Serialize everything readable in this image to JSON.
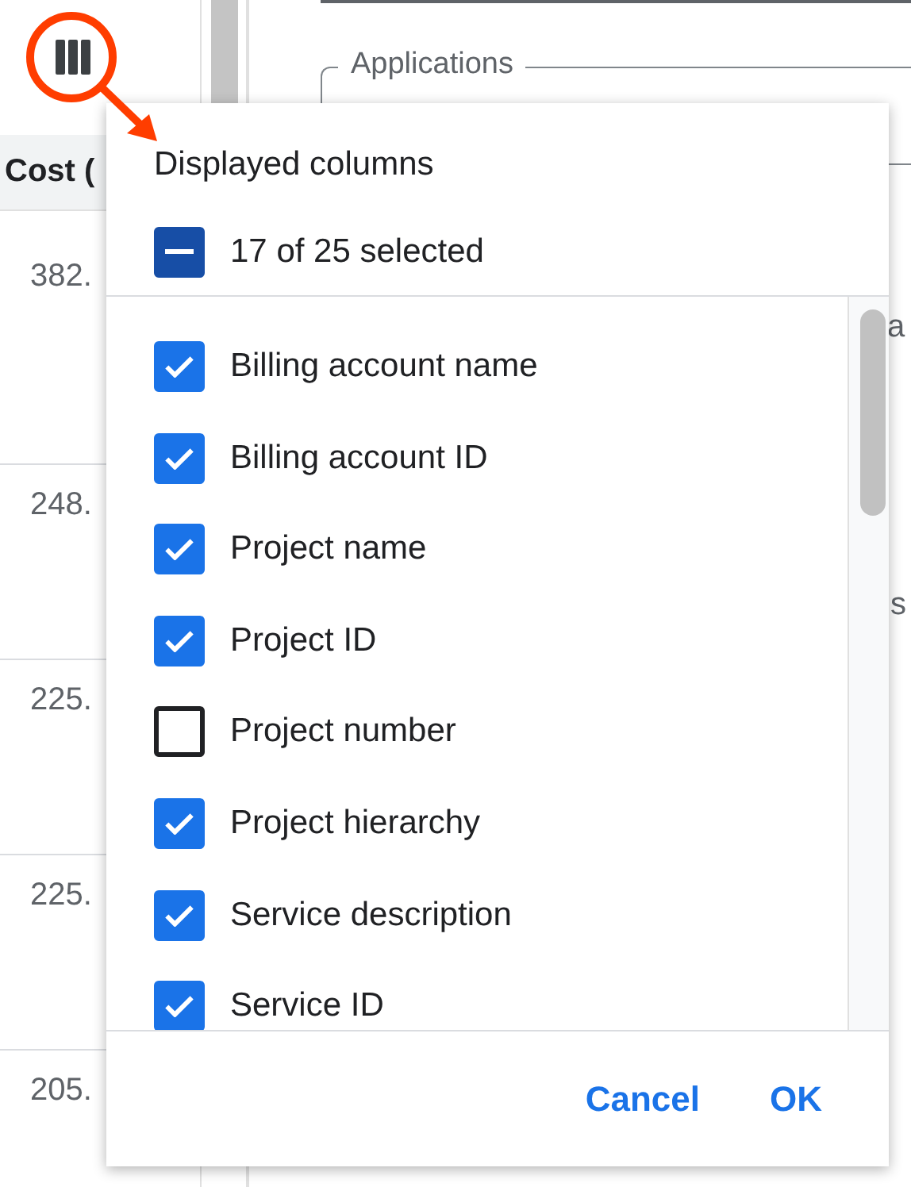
{
  "table": {
    "columns": [
      "Cost ("
    ],
    "rows": [
      [
        "382."
      ],
      [
        "248."
      ],
      [
        "225."
      ],
      [
        "225."
      ],
      [
        "205."
      ]
    ]
  },
  "filter": {
    "label": "Applications"
  },
  "edge_texts": [
    "a",
    "s"
  ],
  "dialog": {
    "title": "Displayed columns",
    "select_all": {
      "label": "17 of 25 selected",
      "indeterminate": true
    },
    "columns": [
      {
        "label": "Billing account name",
        "checked": true
      },
      {
        "label": "Billing account ID",
        "checked": true
      },
      {
        "label": "Project name",
        "checked": true
      },
      {
        "label": "Project ID",
        "checked": true
      },
      {
        "label": "Project number",
        "checked": false
      },
      {
        "label": "Project hierarchy",
        "checked": true
      },
      {
        "label": "Service description",
        "checked": true
      },
      {
        "label": "Service ID",
        "checked": true
      }
    ],
    "buttons": [
      {
        "label": "Cancel"
      },
      {
        "label": "OK"
      }
    ]
  }
}
